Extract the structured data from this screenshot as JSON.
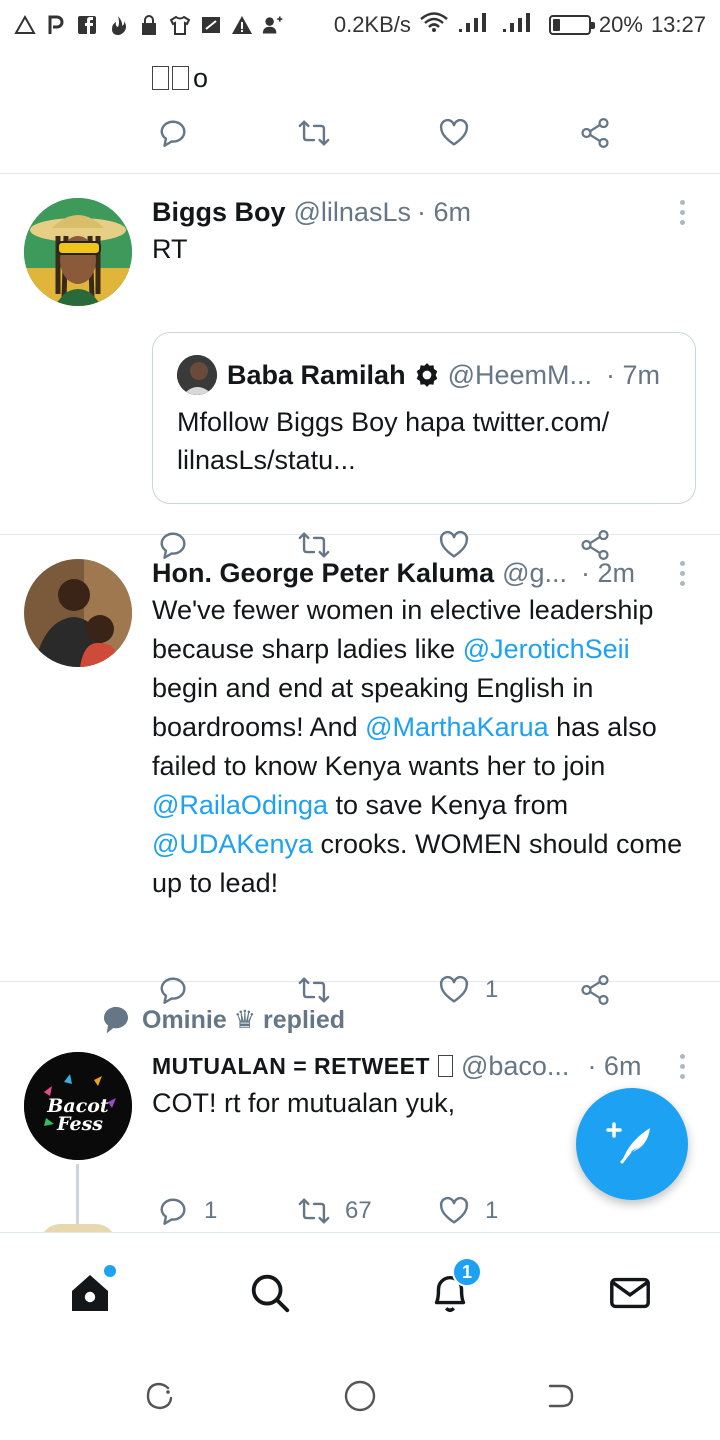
{
  "status_bar": {
    "left_icons": [
      "warning-triangle-icon",
      "p-icon",
      "facebook-icon",
      "fire-icon",
      "lock-icon",
      "shirt-icon",
      "notes-icon",
      "alert-icon",
      "add-person-icon"
    ],
    "net_speed": "0.2KB/s",
    "battery": "20%",
    "battery_level": 0.2,
    "time": "13:27"
  },
  "tweets": {
    "partial": {
      "text": "o"
    },
    "t1": {
      "name": "Biggs Boy",
      "handle": "@lilnasLs",
      "time": "· 6m",
      "text": "RT",
      "quote": {
        "name": "Baba Ramilah",
        "handle": "@HeemM...",
        "time": "· 7m",
        "text": "Mfollow Biggs Boy hapa twitter.com/ lilnasLs/statu..."
      }
    },
    "t2": {
      "name": "Hon. George Peter Kaluma",
      "handle": "@g...",
      "time": "· 2m",
      "text_parts": [
        "We've fewer women in elective leadership because sharp ladies like ",
        "@JerotichSeii",
        " begin and end at speaking English in boardrooms! And ",
        "@MarthaKarua",
        " has also failed to know Kenya wants her to join ",
        "@RailaOdinga",
        " to save Kenya from ",
        "@UDAKenya",
        " crooks. WOMEN should come up to lead!"
      ],
      "like_count": "1"
    },
    "t3": {
      "context": "Ominie ♛ replied",
      "name": "MUTUALAN = RETWEET",
      "handle": "@baco...",
      "time": "· 6m",
      "text": "COT! rt for mutualan yuk,",
      "reply_count": "1",
      "retweet_count": "67",
      "like_count": "1"
    }
  },
  "bottom_nav": {
    "items": [
      "home-icon",
      "search-icon",
      "notifications-icon",
      "messages-icon"
    ],
    "notification_badge": "1"
  },
  "colors": {
    "accent": "#1da1f2",
    "text": "#14171a",
    "secondary": "#657786",
    "divider": "#e1e8ed"
  }
}
